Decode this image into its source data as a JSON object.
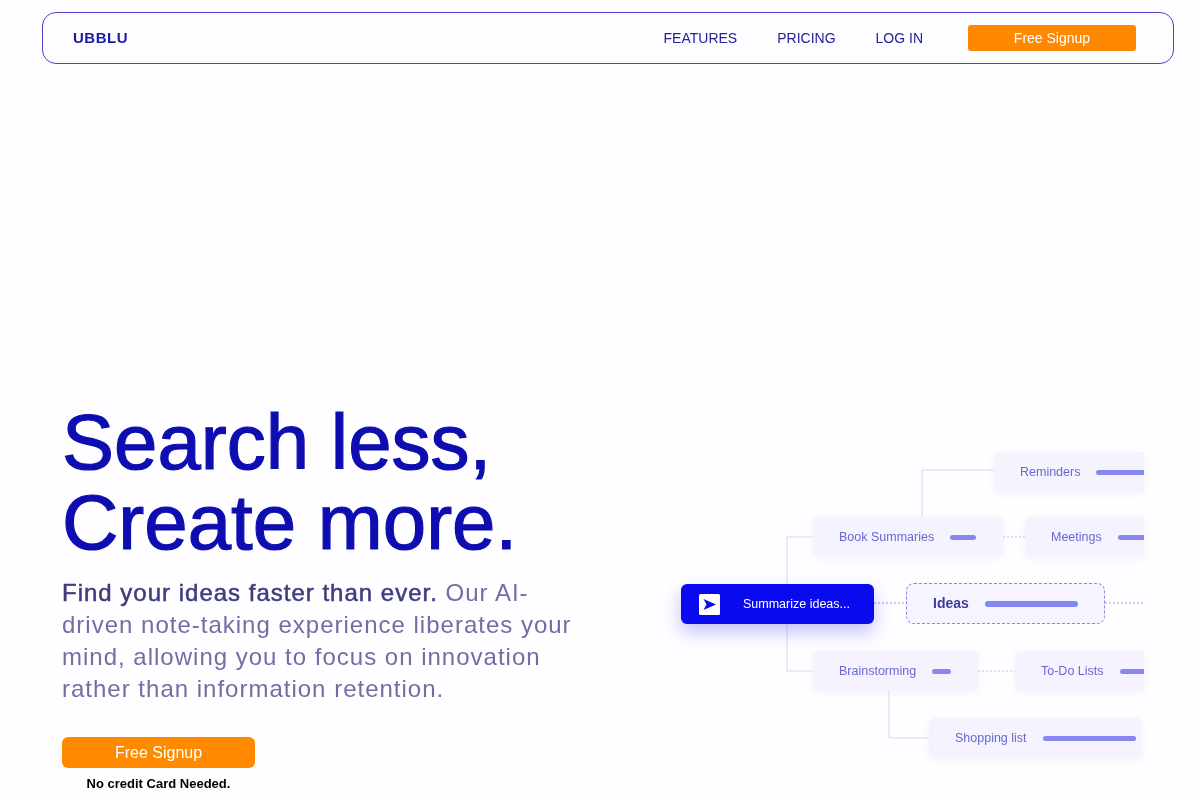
{
  "navbar": {
    "logo": "UBBLU",
    "links": [
      "FEATURES",
      "PRICING",
      "LOG IN"
    ],
    "signup_button": "Free Signup"
  },
  "hero": {
    "headline": [
      "Search less,",
      "Create more."
    ],
    "description": "**Find your ideas faster than ever.** Our AI-driven note-taking experience liberates your mind, allowing you to focus on innovation rather than information retention.",
    "signup_button": "Free Signup",
    "note": "No credit Card Needed."
  },
  "mind_map": {
    "nodes": [
      {
        "label": "Reminders",
        "kind": "branch"
      },
      {
        "label": "Book Summaries",
        "kind": "branch"
      },
      {
        "label": "Meetings",
        "kind": "branch"
      },
      {
        "label": "Summarize ideas...",
        "kind": "prompt"
      },
      {
        "label": "Ideas",
        "kind": "focus"
      },
      {
        "label": "Brainstorming",
        "kind": "branch"
      },
      {
        "label": "To-Do Lists",
        "kind": "branch"
      },
      {
        "label": "Shopping list",
        "kind": "branch"
      }
    ]
  }
}
